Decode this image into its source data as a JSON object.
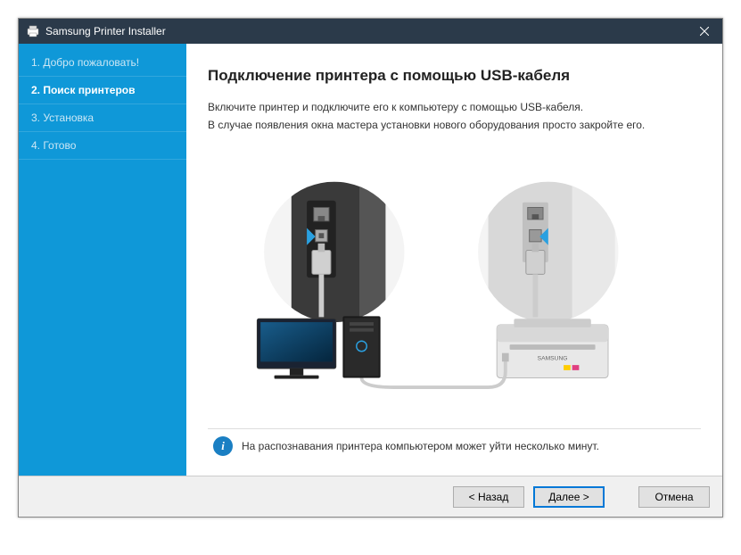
{
  "titlebar": {
    "title": "Samsung Printer Installer"
  },
  "sidebar": {
    "steps": [
      {
        "label": "1. Добро пожаловать!"
      },
      {
        "label": "2. Поиск принтеров"
      },
      {
        "label": "3. Установка"
      },
      {
        "label": "4. Готово"
      }
    ],
    "active_index": 1
  },
  "content": {
    "heading": "Подключение принтера с помощью USB-кабеля",
    "paragraph1": "Включите принтер и подключите его к компьютеру с помощью USB-кабеля.",
    "paragraph2": "В случае появления окна мастера установки нового оборудования просто закройте его.",
    "info_note": "На распознавания принтера компьютером может уйти несколько минут."
  },
  "buttons": {
    "back": "< Назад",
    "next": "Далее >",
    "cancel": "Отмена"
  },
  "illustration": {
    "printer_brand": "SAMSUNG"
  }
}
